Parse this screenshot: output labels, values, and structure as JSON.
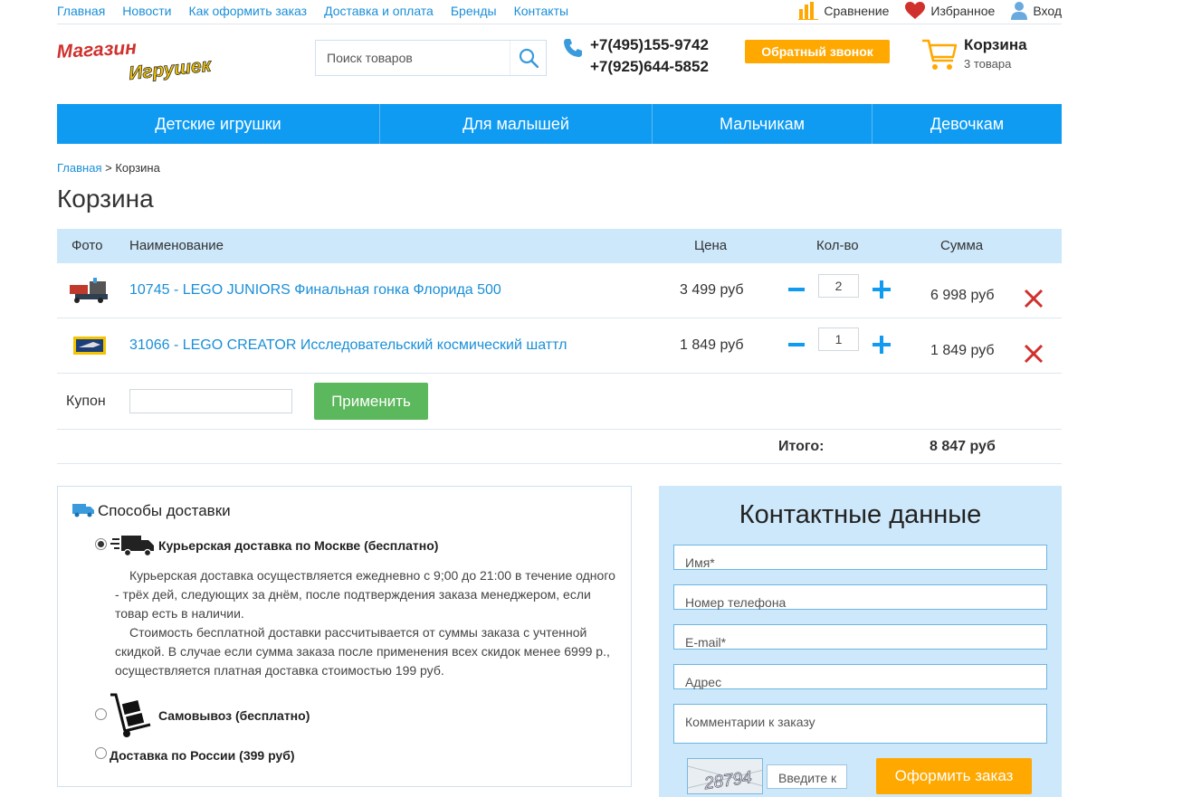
{
  "topnav": {
    "items": [
      "Главная",
      "Новости",
      "Как оформить заказ",
      "Доставка и оплата",
      "Бренды",
      "Контакты"
    ],
    "compare": "Сравнение",
    "favorites": "Избранное",
    "login": "Вход"
  },
  "header": {
    "logo_line1": "Магазин",
    "logo_line2": "Игрушек",
    "search_placeholder": "Поиск товаров",
    "phone1": "+7(495)155-9742",
    "phone2": "+7(925)644-5852",
    "callback": "Обратный звонок",
    "cart_title": "Корзина",
    "cart_count": "3 товара"
  },
  "mainnav": [
    "Детские игрушки",
    "Для малышей",
    "Мальчикам",
    "Девочкам"
  ],
  "breadcrumb": {
    "home": "Главная",
    "sep": ">",
    "current": "Корзина"
  },
  "page_title": "Корзина",
  "table": {
    "headers": {
      "photo": "Фото",
      "name": "Наименование",
      "price": "Цена",
      "qty": "Кол-во",
      "sum": "Сумма"
    },
    "rows": [
      {
        "name": "10745 - LEGO JUNIORS Финальная гонка Флорида 500",
        "price": "3 499 руб",
        "qty": "2",
        "sum": "6 998 руб"
      },
      {
        "name": "31066 - LEGO CREATOR Исследовательский космический шаттл",
        "price": "1 849 руб",
        "qty": "1",
        "sum": "1 849 руб"
      }
    ]
  },
  "coupon": {
    "label": "Купон",
    "value": "",
    "apply": "Применить"
  },
  "total": {
    "label": "Итого:",
    "value": "8 847 руб"
  },
  "delivery": {
    "title": "Способы доставки",
    "options": [
      {
        "title": "Курьерская доставка по Москве (бесплатно)",
        "selected": true
      },
      {
        "title": "Самовывоз (бесплатно)",
        "selected": false
      },
      {
        "title": "Доставка по России (399 руб)",
        "selected": false
      }
    ],
    "desc1": "Курьерская доставка осуществляется ежедневно с 9;00 до 21:00 в течение одного - трёх дей, следующих за днём, после подтверждения заказа менеджером, если товар есть в наличии.",
    "desc2": "Стоимость бесплатной доставки рассчитывается от суммы заказа с учтенной скидкой. В случае если сумма заказа после применения всех скидок менее 6999 р., осуществляется платная доставка стоимостью 199 руб."
  },
  "contact": {
    "title": "Контактные данные",
    "name_placeholder": "Имя*",
    "phone_placeholder": "Номер телефона",
    "email_placeholder": "E-mail*",
    "address_placeholder": "Адрес",
    "comment_placeholder": "Комментарии к заказу",
    "captcha_text": "28794",
    "captcha_placeholder": "Введите к",
    "submit": "Оформить заказ"
  },
  "colors": {
    "accent": "#0f9bf2",
    "orange": "#ffa800",
    "green": "#5cb85c",
    "panel": "#cde8fb",
    "delete": "#d0312d"
  }
}
